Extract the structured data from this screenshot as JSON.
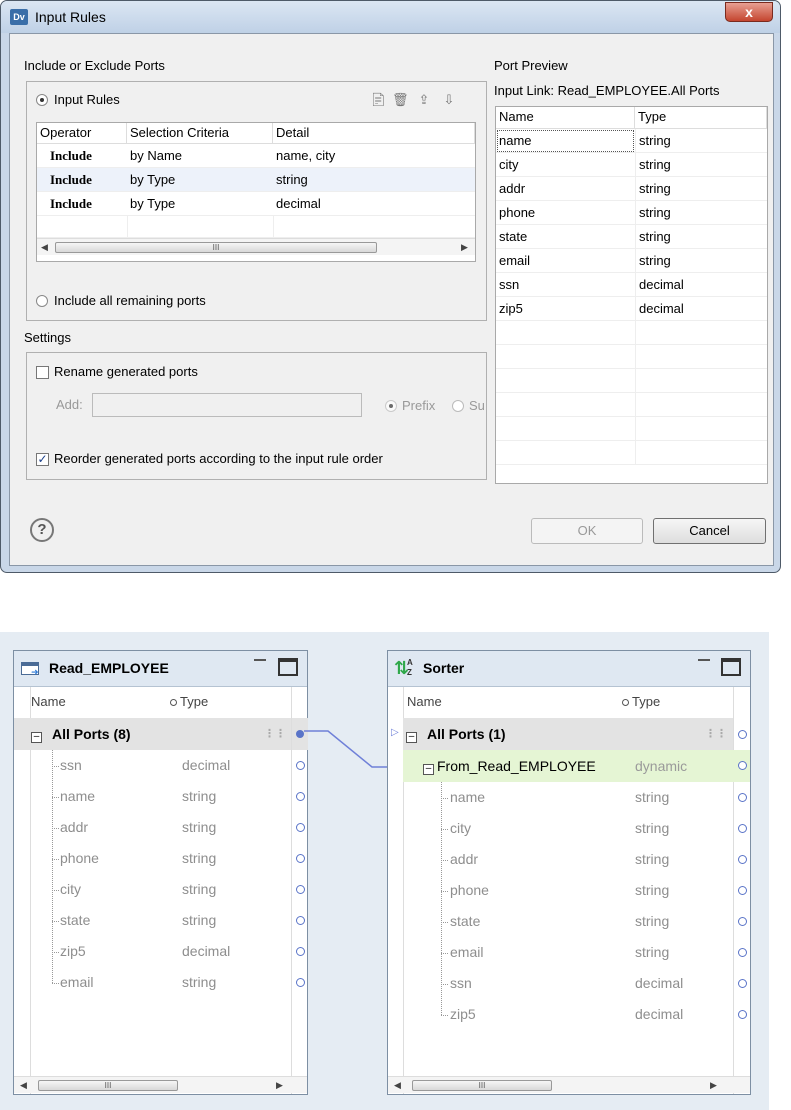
{
  "dialog": {
    "title": "Input Rules",
    "app_icon": "Dv",
    "close_icon": "x",
    "include_exclude_label": "Include or Exclude Ports",
    "input_rules_label": "Input Rules",
    "rules_table": {
      "headers": [
        "Operator",
        "Selection Criteria",
        "Detail"
      ],
      "rows": [
        {
          "operator": "Include",
          "criteria": "by Name",
          "detail": "name, city"
        },
        {
          "operator": "Include",
          "criteria": "by Type",
          "detail": "string"
        },
        {
          "operator": "Include",
          "criteria": "by Type",
          "detail": "decimal"
        }
      ]
    },
    "include_remaining_label": "Include all remaining ports",
    "settings_label": "Settings",
    "rename_label": "Rename generated ports",
    "rename_checked": false,
    "add_label": "Add:",
    "add_value": "",
    "prefix_label": "Prefix",
    "suffix_label": "Su",
    "reorder_label": "Reorder generated ports according to the input rule order",
    "reorder_checked": true,
    "port_preview_label": "Port Preview",
    "input_link_label": "Input Link: Read_EMPLOYEE.All Ports",
    "preview_table": {
      "headers": [
        "Name",
        "Type"
      ],
      "rows": [
        {
          "name": "name",
          "type": "string"
        },
        {
          "name": "city",
          "type": "string"
        },
        {
          "name": "addr",
          "type": "string"
        },
        {
          "name": "phone",
          "type": "string"
        },
        {
          "name": "state",
          "type": "string"
        },
        {
          "name": "email",
          "type": "string"
        },
        {
          "name": "ssn",
          "type": "decimal"
        },
        {
          "name": "zip5",
          "type": "decimal"
        }
      ]
    },
    "help_icon": "?",
    "ok_label": "OK",
    "cancel_label": "Cancel",
    "scroll_grip": "III"
  },
  "mapping": {
    "read_node": {
      "title": "Read_EMPLOYEE",
      "col_name": "Name",
      "col_type": "Type",
      "group_label": "All Ports (8)",
      "ports": [
        {
          "name": "ssn",
          "type": "decimal"
        },
        {
          "name": "name",
          "type": "string"
        },
        {
          "name": "addr",
          "type": "string"
        },
        {
          "name": "phone",
          "type": "string"
        },
        {
          "name": "city",
          "type": "string"
        },
        {
          "name": "state",
          "type": "string"
        },
        {
          "name": "zip5",
          "type": "decimal"
        },
        {
          "name": "email",
          "type": "string"
        }
      ]
    },
    "sorter_node": {
      "title": "Sorter",
      "col_name": "Name",
      "col_type": "Type",
      "group_label": "All Ports (1)",
      "dynamic_label": "From_Read_EMPLOYEE",
      "dynamic_type": "dynamic",
      "ports": [
        {
          "name": "name",
          "type": "string"
        },
        {
          "name": "city",
          "type": "string"
        },
        {
          "name": "addr",
          "type": "string"
        },
        {
          "name": "phone",
          "type": "string"
        },
        {
          "name": "state",
          "type": "string"
        },
        {
          "name": "email",
          "type": "string"
        },
        {
          "name": "ssn",
          "type": "decimal"
        },
        {
          "name": "zip5",
          "type": "decimal"
        }
      ]
    }
  }
}
